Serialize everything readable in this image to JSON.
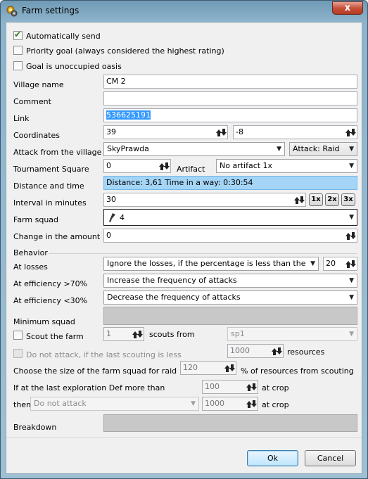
{
  "window": {
    "title": "Farm settings",
    "close_symbol": "x"
  },
  "options": {
    "auto_send": {
      "label": "Automatically send",
      "checked": true
    },
    "priority_goal": {
      "label": "Priority goal (always considered the highest rating)",
      "checked": false
    },
    "unoccupied_oasis": {
      "label": "Goal is unoccupied oasis",
      "checked": false
    }
  },
  "fields": {
    "village_name": {
      "label": "Village name",
      "value": "CM 2"
    },
    "comment": {
      "label": "Comment",
      "value": ""
    },
    "link": {
      "label": "Link",
      "value": "536625191"
    },
    "coordinates": {
      "label": "Coordinates",
      "x": "39",
      "y": "-8"
    },
    "attack_from": {
      "label": "Attack from the village",
      "village": "SkyPrawda",
      "attack_type": "Attack: Raid"
    },
    "tournament": {
      "label": "Tournament Square",
      "value": "0",
      "artifact_label": "Artifact",
      "artifact": "No artifact 1x"
    },
    "distance": {
      "label": "Distance and time",
      "value": "Distance: 3,61 Time in a way: 0:30:54"
    },
    "interval": {
      "label": "Interval in minutes",
      "value": "30",
      "btn_1x": "1x",
      "btn_2x": "2x",
      "btn_3x": "3x"
    },
    "farm_squad": {
      "label": "Farm squad",
      "value": "4"
    },
    "change_amount": {
      "label": "Change in the amount",
      "value": "0"
    }
  },
  "behavior": {
    "section_label": "Behavior",
    "at_losses": {
      "label": "At losses",
      "value": "Ignore the losses, if the percentage is less than the threshold",
      "threshold": "20"
    },
    "eff_high": {
      "label": "At efficiency >70%",
      "value": "Increase the frequency of attacks"
    },
    "eff_low": {
      "label": "At efficiency <30%",
      "value": "Decrease the frequency of attacks"
    },
    "min_squad": {
      "label": "Minimum squad",
      "value": ""
    },
    "scout": {
      "label": "Scout the farm",
      "checked": false,
      "count": "1",
      "from_label": "scouts from",
      "village": "sp1"
    },
    "do_not_attack": {
      "label": "Do not attack, if the last scouting is less",
      "checked": false,
      "value": "1000",
      "unit": "resources"
    },
    "squad_size": {
      "label": "Choose the size of the farm squad for raid",
      "value": "120",
      "unit": "% of resources from scouting"
    },
    "def_more": {
      "label": "If at the last exploration Def more than",
      "value": "100",
      "unit": "at crop"
    },
    "then": {
      "label": "then",
      "action": "Do not attack",
      "value": "1000",
      "unit": "at crop"
    },
    "breakdown": {
      "label": "Breakdown",
      "value": ""
    }
  },
  "buttons": {
    "ok": "Ok",
    "cancel": "Cancel"
  },
  "colors": {
    "accent_selection": "#3399ff",
    "info_background": "#a5d5f6",
    "checkmark": "#2b7a14"
  }
}
